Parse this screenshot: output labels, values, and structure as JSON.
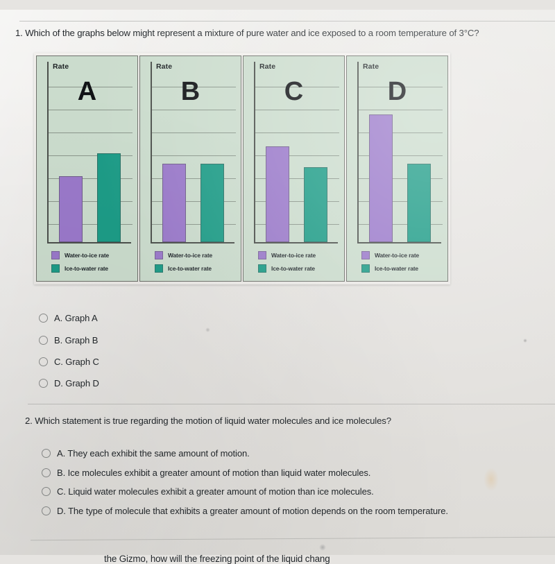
{
  "page": {
    "background_color": "#e6e4e1",
    "paper_color": "#e8e6e3"
  },
  "questions": [
    {
      "id": "q1",
      "text": "1. Which of the graphs below might represent a mixture of pure water and ice exposed to a room temperature of 3°C?",
      "options": [
        {
          "letter": "A",
          "label": "A. Graph A",
          "selected": false
        },
        {
          "letter": "B",
          "label": "B. Graph B",
          "selected": false
        },
        {
          "letter": "C",
          "label": "C. Graph C",
          "selected": false
        },
        {
          "letter": "D",
          "label": "D. Graph D",
          "selected": false
        }
      ]
    },
    {
      "id": "q2",
      "text": "2. Which statement is true regarding the motion of liquid water molecules and ice molecules?",
      "options": [
        {
          "letter": "A",
          "label": "A. They each exhibit the same amount of motion.",
          "selected": false
        },
        {
          "letter": "B",
          "label": "B. Ice molecules exhibit a greater amount of motion than liquid water molecules.",
          "selected": false
        },
        {
          "letter": "C",
          "label": "C. Liquid water molecules exhibit a greater amount of motion than ice molecules.",
          "selected": false
        },
        {
          "letter": "D",
          "label": "D. The type of molecule that exhibits a greater amount of motion depends on the room temperature.",
          "selected": false
        }
      ]
    },
    {
      "id": "q3",
      "text": "the Gizmo, how will the freezing point of the liquid chang"
    }
  ],
  "graph_figure": {
    "axis_label": "Rate",
    "legend": {
      "water_to_ice": "Water-to-ice rate",
      "ice_to_water": "Ice-to-water rate"
    },
    "colors": {
      "water_to_ice": "#9a79ca",
      "ice_to_water": "#1d9c87",
      "panel_background": "#cbdccd",
      "panel_border": "#6d6f6a",
      "axis": "#4b4f4b",
      "gridline": "#555c55"
    }
  },
  "chart_data": {
    "type": "bar",
    "title": "Which of the graphs below might represent a mixture of pure water and ice exposed to a room temperature of 3°C?",
    "xlabel": "",
    "ylabel": "Rate",
    "ylim": [
      0,
      100
    ],
    "grid": true,
    "legend_position": "below-plot",
    "categories": [
      "Water-to-ice rate",
      "Ice-to-water rate"
    ],
    "panels": [
      {
        "letter": "A",
        "label": "Graph A",
        "series": [
          {
            "name": "Water-to-ice rate",
            "value": 37,
            "color": "#9a79ca"
          },
          {
            "name": "Ice-to-water rate",
            "value": 50,
            "color": "#1d9c87"
          }
        ],
        "relation": "ice-to-water greater than water-to-ice"
      },
      {
        "letter": "B",
        "label": "Graph B",
        "series": [
          {
            "name": "Water-to-ice rate",
            "value": 44,
            "color": "#9a79ca"
          },
          {
            "name": "Ice-to-water rate",
            "value": 44,
            "color": "#1d9c87"
          }
        ],
        "relation": "rates equal"
      },
      {
        "letter": "C",
        "label": "Graph C",
        "series": [
          {
            "name": "Water-to-ice rate",
            "value": 54,
            "color": "#9a79ca"
          },
          {
            "name": "Ice-to-water rate",
            "value": 42,
            "color": "#1d9c87"
          }
        ],
        "relation": "water-to-ice greater than ice-to-water"
      },
      {
        "letter": "D",
        "label": "Graph D",
        "series": [
          {
            "name": "Water-to-ice rate",
            "value": 72,
            "color": "#9a79ca"
          },
          {
            "name": "Ice-to-water rate",
            "value": 44,
            "color": "#1d9c87"
          }
        ],
        "relation": "water-to-ice much greater than ice-to-water"
      }
    ]
  }
}
